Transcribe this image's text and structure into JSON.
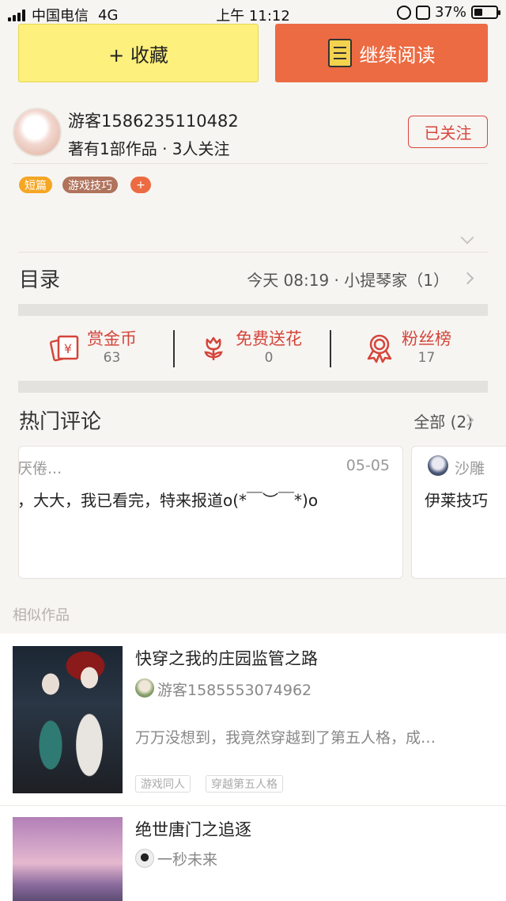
{
  "status_bar": {
    "carrier": "中国电信",
    "network": "4G",
    "time": "上午 11:12",
    "battery": "37%",
    "battery_level": 0.37
  },
  "actions": {
    "collect_label": "+ 收藏",
    "read_label": "继续阅读"
  },
  "author": {
    "name": "游客1586235110482",
    "meta": "著有1部作品 · 3人关注",
    "follow_label": "已关注"
  },
  "tags": [
    {
      "label": "短篇",
      "color": "#f5a623"
    },
    {
      "label": "游戏技巧",
      "color": "#b0735c"
    },
    {
      "label": "+",
      "color": "#ec6b42"
    }
  ],
  "catalog": {
    "title": "目录",
    "latest": "今天 08:19 · 小提琴家（1）"
  },
  "stats": [
    {
      "label": "赏金币",
      "value": "63",
      "icon": "red-packet-icon"
    },
    {
      "label": "免费送花",
      "value": "0",
      "icon": "flower-icon"
    },
    {
      "label": "粉丝榜",
      "value": "17",
      "icon": "medal-icon"
    }
  ],
  "comments": {
    "title": "热门评论",
    "all_label": "全部 (2)",
    "items": [
      {
        "user": "厌倦...",
        "date": "05-05",
        "text": "，大大，我已看完，特来报道o(*￣︶￣*)o"
      },
      {
        "user": "沙雕",
        "text": "伊莱技巧"
      }
    ]
  },
  "similar": {
    "header": "相似作品",
    "items": [
      {
        "title": "快穿之我的庄园监管之路",
        "author": "游客1585553074962",
        "desc": "万万没想到，我竟然穿越到了第五人格，成…",
        "tags": [
          "游戏同人",
          "穿越第五人格"
        ]
      },
      {
        "title": "绝世唐门之追逐",
        "author": "一秒未来"
      }
    ]
  },
  "colors": {
    "accent_orange": "#ec6b42",
    "collect_yellow": "#fdf07c",
    "follow_red": "#d9463d",
    "stat_red": "#d4453b"
  }
}
